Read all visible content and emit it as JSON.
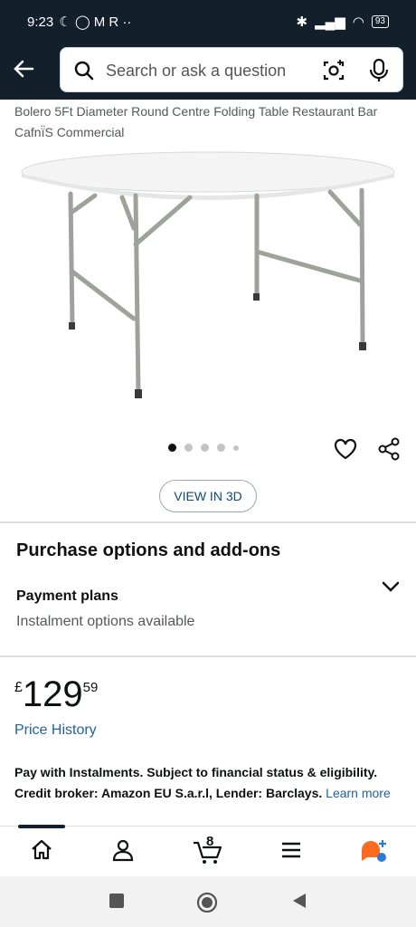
{
  "status": {
    "time": "9:23",
    "left_icons": "☾ ◯ M R ··",
    "battery": "93"
  },
  "search": {
    "placeholder": "Search or ask a question"
  },
  "product": {
    "title": "Bolero 5Ft Diameter Round Centre Folding Table Restaurant Bar Cafnï̈S Commercial",
    "image_count": 5,
    "active_image": 1,
    "view3d_label": "VIEW IN 3D"
  },
  "purchase": {
    "section_title": "Purchase options and add-ons",
    "payment_label": "Payment plans",
    "payment_sub": "Instalment options available"
  },
  "price": {
    "currency": "£",
    "whole": "129",
    "fraction": "59"
  },
  "price_history_label": "Price History",
  "instalment": {
    "text": "Pay with Instalments. Subject to financial status & eligibility. Credit broker: Amazon EU S.a.r.l, Lender: Barclays.",
    "learn_more": "Learn more"
  },
  "nav": {
    "cart_count": "8"
  },
  "colors": {
    "header": "#13202c",
    "link": "#2162a1",
    "accent": "#ff6a1f"
  }
}
